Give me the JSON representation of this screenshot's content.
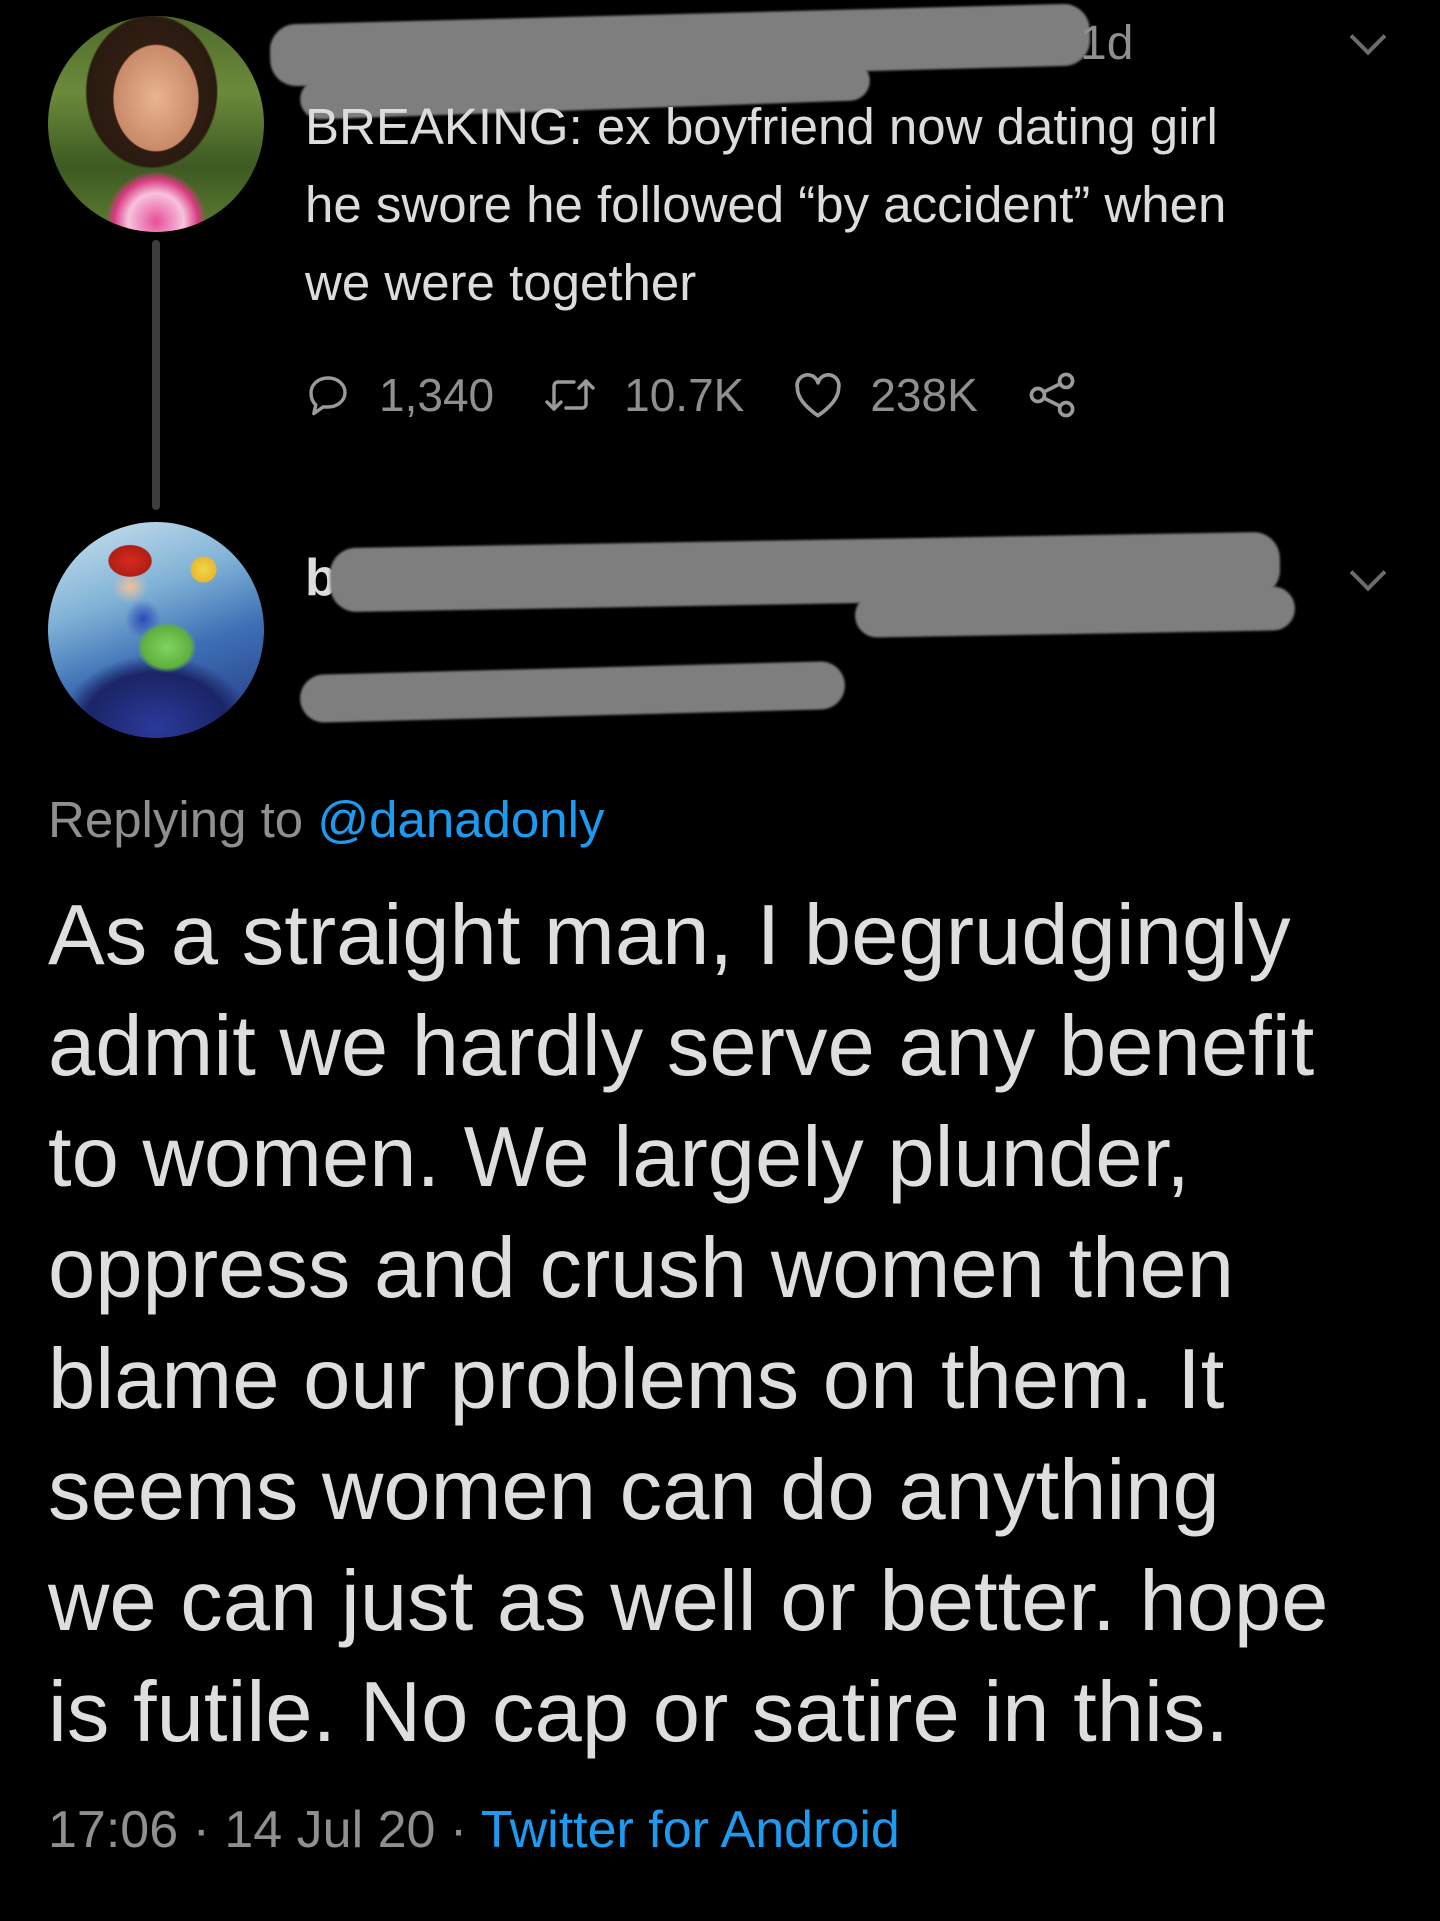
{
  "tweet": {
    "timestamp": "1d",
    "text": "BREAKING: ex boyfriend now dating girl\nhe swore he followed “by accident” when\nwe were together",
    "stats": {
      "replies": "1,340",
      "retweets": "10.7K",
      "likes": "238K"
    }
  },
  "reply": {
    "name_fragment": "b",
    "replying_prefix": "Replying to",
    "replying_handle": "@danadonly",
    "text": "As a straight man, I begrudgingly\nadmit we hardly serve any benefit\nto women. We largely plunder,\noppress and crush women then\nblame our problems on them. It\nseems women can do anything\nwe can just as well or better. hope\nis futile. No cap or satire in this.",
    "time": "17:06",
    "date": "14 Jul 20",
    "separator": "·",
    "source": "Twitter for Android"
  },
  "colors": {
    "background": "#000000",
    "text": "#dcdcdc",
    "secondary": "#8f8f8f",
    "link": "#1d9bf0",
    "redaction": "#7e7e7e"
  },
  "icons": [
    "reply-icon",
    "retweet-icon",
    "like-icon",
    "share-icon",
    "chevron-down-icon"
  ]
}
